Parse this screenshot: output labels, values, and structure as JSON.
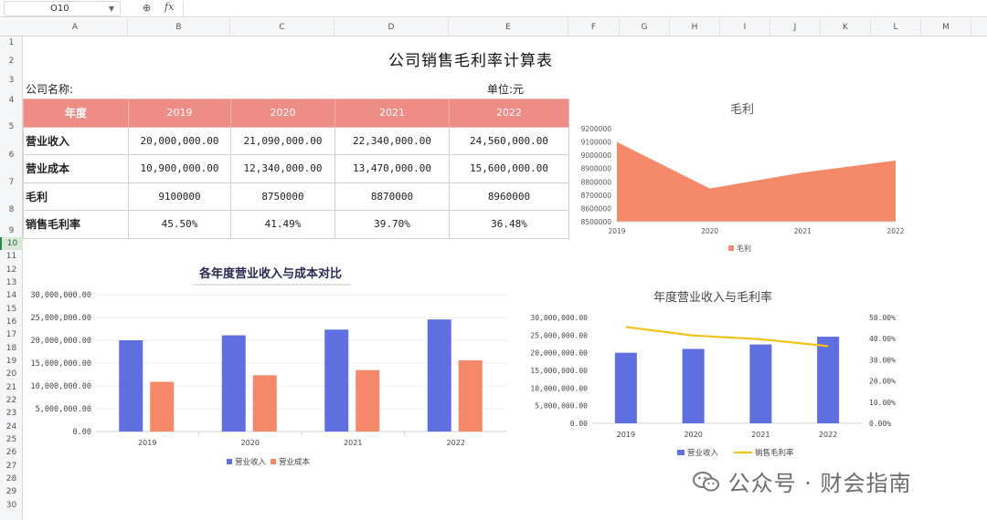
{
  "formula_bar": {
    "cell_ref": "O10",
    "zoom_icon": "zoom-icon",
    "fx_label": "fx"
  },
  "columns": [
    "A",
    "B",
    "C",
    "D",
    "E",
    "F",
    "G",
    "H",
    "I",
    "J",
    "K",
    "L",
    "M"
  ],
  "rows": [
    "1",
    "2",
    "3",
    "4",
    "5",
    "6",
    "7",
    "8",
    "9",
    "10",
    "11",
    "12",
    "13",
    "14",
    "15",
    "16",
    "17",
    "18",
    "19",
    "20",
    "21",
    "22",
    "23",
    "24",
    "25",
    "26",
    "27",
    "28",
    "29",
    "30"
  ],
  "selected_row": "10",
  "sheet": {
    "title": "公司销售毛利率计算表",
    "company_label": "公司名称:",
    "unit_label": "单位:元",
    "header": [
      "年度",
      "2019",
      "2020",
      "2021",
      "2022"
    ],
    "table": [
      {
        "label": "营业收入",
        "values": [
          "20,000,000.00",
          "21,090,000.00",
          "22,340,000.00",
          "24,560,000.00"
        ]
      },
      {
        "label": "营业成本",
        "values": [
          "10,900,000.00",
          "12,340,000.00",
          "13,470,000.00",
          "15,600,000.00"
        ]
      },
      {
        "label": "毛利",
        "values": [
          "9100000",
          "8750000",
          "8870000",
          "8960000"
        ]
      },
      {
        "label": "销售毛利率",
        "values": [
          "45.50%",
          "41.49%",
          "39.70%",
          "36.48%"
        ]
      }
    ]
  },
  "colors": {
    "header_bg": "#ee8c86",
    "blue": "#5f6fe0",
    "orange": "#f4896a",
    "yellow": "#f2c21a"
  },
  "chart_data": [
    {
      "type": "area",
      "title": "毛利",
      "categories": [
        "2019",
        "2020",
        "2021",
        "2022"
      ],
      "series": [
        {
          "name": "毛利",
          "values": [
            9100000,
            8750000,
            8870000,
            8960000
          ]
        }
      ],
      "ylim": [
        8500000,
        9200000
      ],
      "yticks": [
        "9200000",
        "9100000",
        "9000000",
        "8900000",
        "8800000",
        "8700000",
        "8600000",
        "8500000"
      ],
      "legend": "bottom"
    },
    {
      "type": "bar",
      "title": "各年度营业收入与成本对比",
      "categories": [
        "2019",
        "2020",
        "2021",
        "2022"
      ],
      "series": [
        {
          "name": "营业收入",
          "values": [
            20000000,
            21090000,
            22340000,
            24560000
          ]
        },
        {
          "name": "营业成本",
          "values": [
            10900000,
            12340000,
            13470000,
            15600000
          ]
        }
      ],
      "ylim": [
        0,
        30000000
      ],
      "yticks": [
        "30,000,000.00",
        "25,000,000.00",
        "20,000,000.00",
        "15,000,000.00",
        "10,000,000.00",
        "5,000,000.00",
        "0.00"
      ],
      "legend": "bottom"
    },
    {
      "type": "bar",
      "title": "年度营业收入与毛利率",
      "categories": [
        "2019",
        "2020",
        "2021",
        "2022"
      ],
      "series": [
        {
          "name": "营业收入",
          "type": "bar",
          "values": [
            20000000,
            21090000,
            22340000,
            24560000
          ]
        },
        {
          "name": "销售毛利率",
          "type": "line",
          "axis": "right",
          "values": [
            45.5,
            41.49,
            39.7,
            36.48
          ]
        }
      ],
      "ylim": [
        0,
        30000000
      ],
      "y2lim": [
        0,
        50
      ],
      "yticks": [
        "30,000,000.00",
        "25,000,000.00",
        "20,000,000.00",
        "15,000,000.00",
        "10,000,000.00",
        "5,000,000.00",
        "0.00"
      ],
      "y2ticks": [
        "50.00%",
        "40.00%",
        "30.00%",
        "20.00%",
        "10.00%",
        "0.00%"
      ],
      "legend": "bottom"
    }
  ],
  "watermark": {
    "text": "公众号 · 财会指南",
    "icon": "wechat-icon"
  }
}
